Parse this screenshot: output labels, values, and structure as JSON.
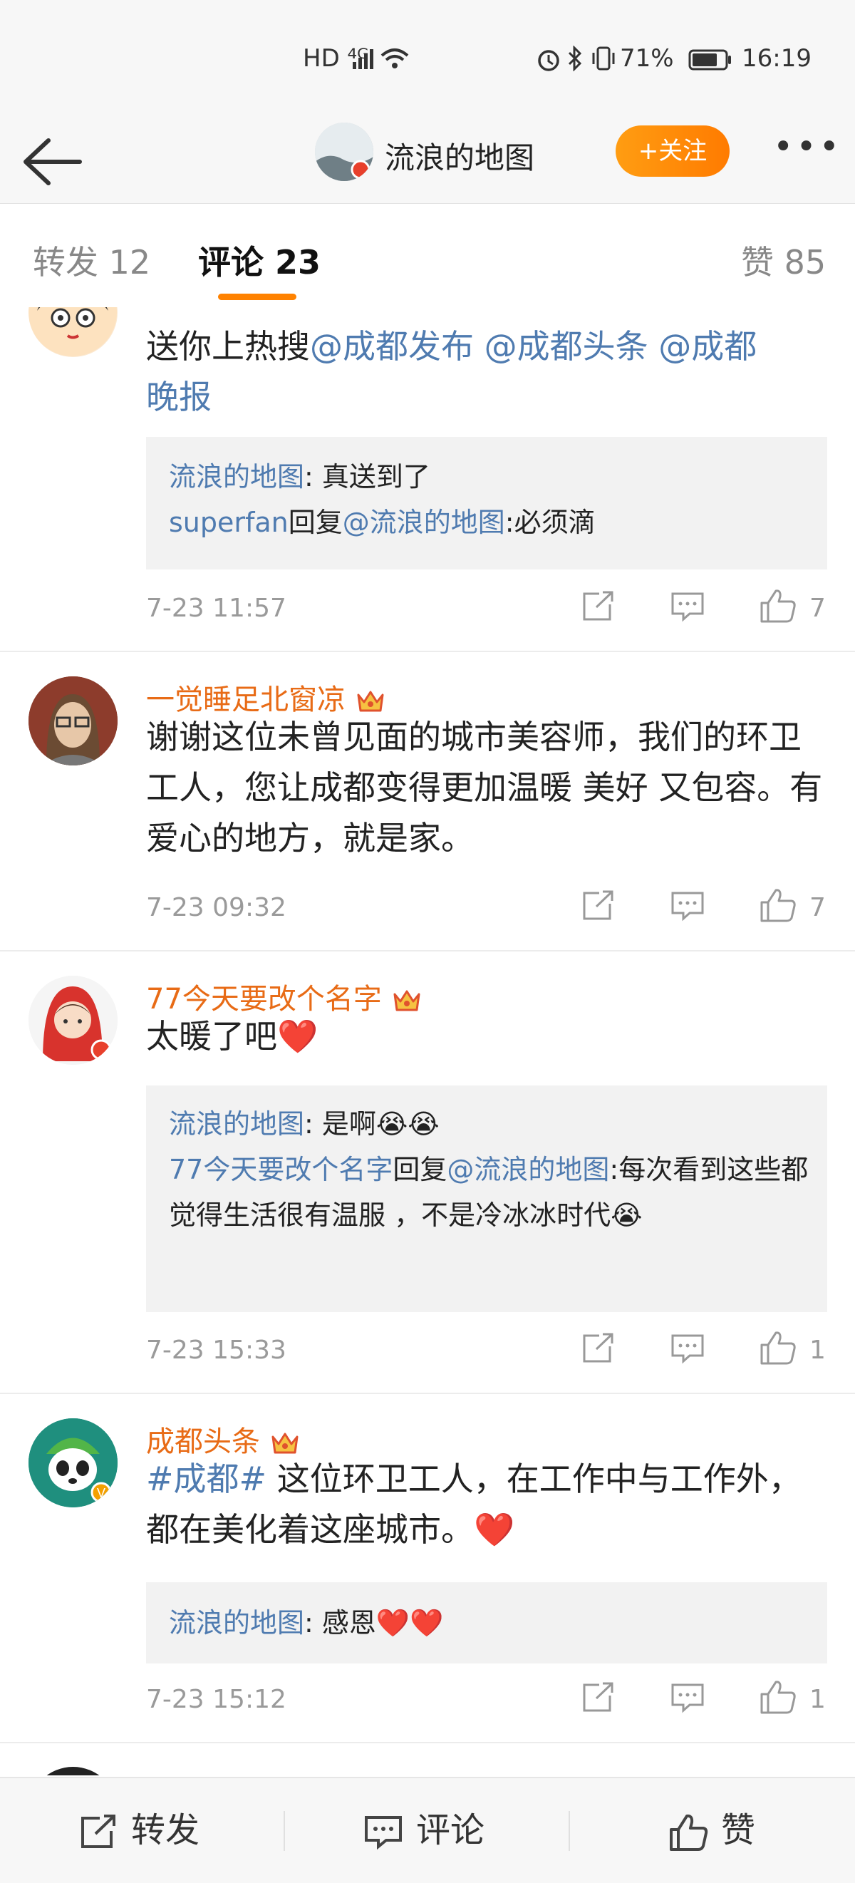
{
  "status_bar": {
    "network": "HD ⁴ᴳ",
    "battery_percent": "71%",
    "time": "16:19"
  },
  "header": {
    "title": "流浪的地图",
    "follow_label": "+关注"
  },
  "tabs": [
    {
      "label": "转发 12"
    },
    {
      "label": "评论 23"
    },
    {
      "label": "赞 85"
    }
  ],
  "comments": [
    {
      "text_parts": [
        "送你上热搜",
        "@成都发布 @成都头条 @成都",
        "晚报"
      ],
      "replies": [
        {
          "author": "流浪的地图",
          "sep": ": ",
          "body": "真送到了"
        },
        {
          "author": "superfan",
          "mid": "回复",
          "mention": "@流浪的地图",
          "body": ":必须滴"
        }
      ],
      "time": "7-23 11:57",
      "likes": "7"
    },
    {
      "username": "一觉睡足北窗凉",
      "text": "谢谢这位未曾见面的城市美容师，我们的环卫工人，您让成都变得更加温暖 美好 又包容。有爱心的地方，就是家。",
      "time": "7-23 09:32",
      "likes": "7"
    },
    {
      "username": "77今天要改个名字",
      "text": "太暖了吧❤️",
      "replies": [
        {
          "author": "流浪的地图",
          "sep": ": ",
          "body": "是啊😭😭"
        },
        {
          "author": "77今天要改个名字",
          "mid": "回复",
          "mention": "@流浪的地图",
          "body": ":每次看到这些都觉得生活很有温服 ，不是冷冰冰时代😭"
        }
      ],
      "time": "7-23 15:33",
      "likes": "1"
    },
    {
      "username": "成都头条",
      "tag": "#成都#",
      "text": " 这位环卫工人，在工作中与工作外，都在美化着这座城市。❤️",
      "replies": [
        {
          "author": "流浪的地图",
          "sep": ": ",
          "body": "感恩❤️❤️"
        }
      ],
      "time": "7-23 15:12",
      "likes": "1"
    }
  ],
  "bottom_bar": {
    "repost": "转发",
    "comment": "评论",
    "like": "赞"
  },
  "colors": {
    "accent": "#ff8200",
    "link": "#4f7bb0",
    "username": "#e86b16"
  }
}
